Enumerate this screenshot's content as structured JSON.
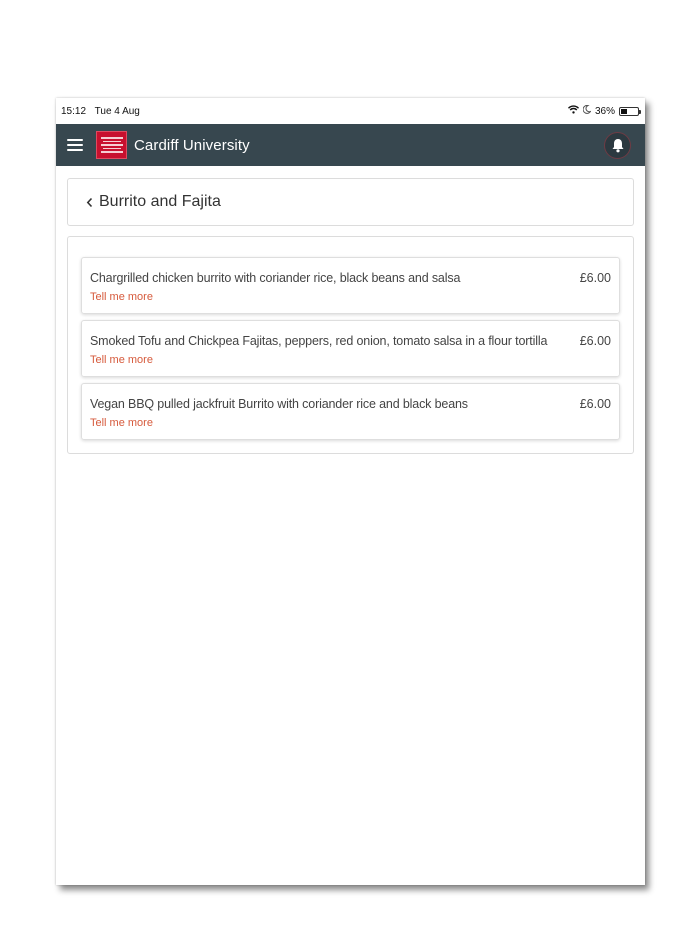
{
  "status_bar": {
    "time": "15:12",
    "date": "Tue 4 Aug",
    "battery": "36%",
    "battery_level": 0.36,
    "icons": [
      "wifi-icon",
      "moon-icon",
      "battery-icon"
    ]
  },
  "header": {
    "title": "Cardiff University",
    "background_color": "#37474f",
    "logo_color": "#c8102e",
    "icons": [
      "hamburger-menu-icon",
      "university-logo",
      "bell-icon"
    ]
  },
  "page": {
    "title": "Burrito and Fajita",
    "back_icon": "chevron-left-icon"
  },
  "menu_items": [
    {
      "name": "Chargrilled chicken burrito with coriander rice, black beans and salsa",
      "price": "£6.00",
      "link": "Tell me more"
    },
    {
      "name": "Smoked Tofu and Chickpea Fajitas, peppers, red onion, tomato salsa in a flour tortilla",
      "price": "£6.00",
      "link": "Tell me more"
    },
    {
      "name": "Vegan BBQ pulled jackfruit Burrito with coriander rice and black beans",
      "price": "£6.00",
      "link": "Tell me more"
    }
  ],
  "colors": {
    "link": "#d65a3c",
    "text": "#444444",
    "border": "#dcdcdc"
  }
}
